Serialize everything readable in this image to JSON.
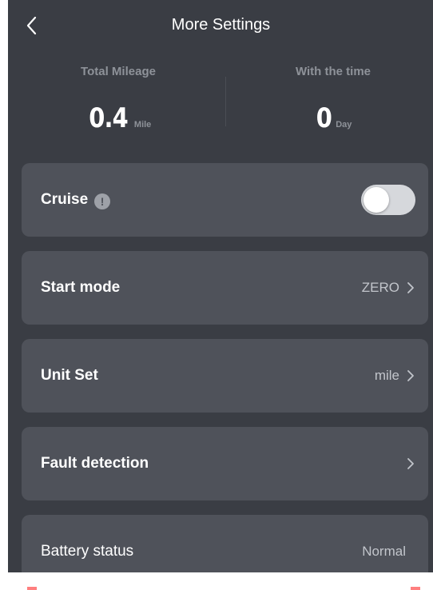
{
  "header": {
    "title": "More Settings",
    "back_icon": "chevron-left-icon"
  },
  "stats": {
    "mileage": {
      "label": "Total Mileage",
      "value": "0.4",
      "unit": "Mile"
    },
    "time": {
      "label": "With the time",
      "value": "0",
      "unit": "Day"
    }
  },
  "settings": {
    "cruise": {
      "label": "Cruise",
      "info_icon": "exclamation-info-icon",
      "info_glyph": "!",
      "enabled": false
    },
    "start_mode": {
      "label": "Start mode",
      "value": "ZERO"
    },
    "unit_set": {
      "label": "Unit Set",
      "value": "mile"
    },
    "fault_detection": {
      "label": "Fault detection"
    },
    "battery_status": {
      "label": "Battery status",
      "value": "Normal"
    }
  },
  "colors": {
    "background": "#3a3d44",
    "card": "#4f525a",
    "text_primary": "#ffffff",
    "text_secondary": "#8e9299",
    "toggle_off": "#d6d8dc"
  }
}
